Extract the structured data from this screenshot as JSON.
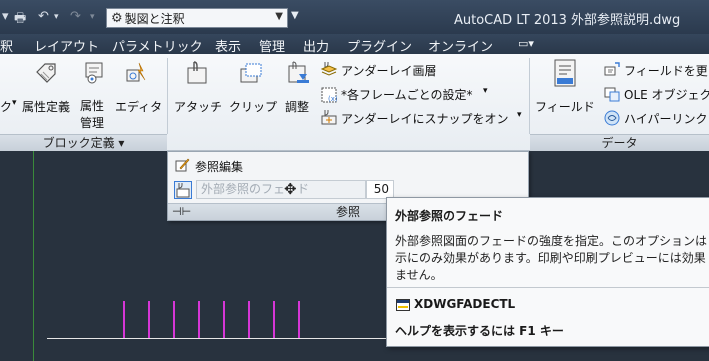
{
  "titlebar": {
    "workspace": "製図と注釈",
    "app_title": "AutoCAD LT 2013   外部参照説明.dwg"
  },
  "menu_tabs": [
    "釈",
    "レイアウト",
    "パラメトリック",
    "表示",
    "管理",
    "出力",
    "プラグイン",
    "オンライン"
  ],
  "ribbon": {
    "block_panel": {
      "title": "ブロック定義 ▾",
      "buttons": [
        "ク",
        "属性定義",
        "属性\n管理",
        "エディタ"
      ]
    },
    "ref_panel": {
      "buttons": [
        "アタッチ",
        "クリップ",
        "調整"
      ],
      "underlay_layer": "アンダーレイ画層",
      "frames": "*各フレームごとの設定*",
      "snap": "アンダーレイにスナップをオン"
    },
    "data_panel": {
      "title": "データ",
      "field": "フィールド",
      "update_field": "フィールドを更",
      "ole": "OLE オブジェク",
      "hyperlink": "ハイパーリンク"
    }
  },
  "ref_dropdown": {
    "edit_ref": "参照編集",
    "fade_label": "外部参照のフェード",
    "fade_value": "50",
    "footer_title": "参照"
  },
  "tooltip": {
    "title": "外部参照のフェード",
    "line1": "外部参照図面のフェードの強度を指定。このオプションは",
    "line2": "示にのみ効果があります。印刷や印刷プレビューには効果",
    "line3": "ません。",
    "command": "XDWGFADECTL",
    "help": "ヘルプを表示するには F1 キー"
  }
}
